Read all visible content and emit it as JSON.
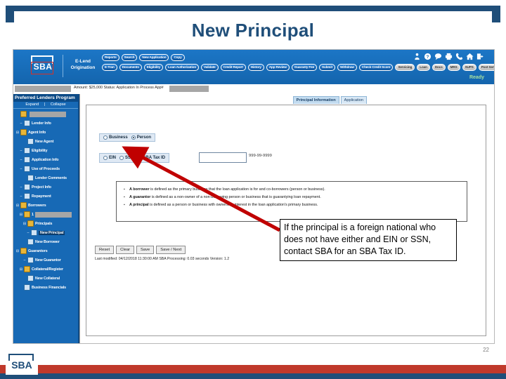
{
  "slide": {
    "title": "New Principal",
    "page_number": "22"
  },
  "app": {
    "brand": "SBA",
    "product_line1": "E-Lend",
    "product_line2": "Origination",
    "status": "Ready",
    "nav_row1": [
      "Reports",
      "Search",
      "New Application",
      "Copy"
    ],
    "nav_row2": [
      {
        "label": "E-Tran",
        "style": "blue"
      },
      {
        "label": "Documents",
        "style": "blue"
      },
      {
        "label": "Eligibility",
        "style": "blue"
      },
      {
        "label": "Loan Authorization",
        "style": "blue"
      },
      {
        "label": "Validate",
        "style": "blue"
      },
      {
        "label": "Credit Report",
        "style": "blue"
      },
      {
        "label": "History",
        "style": "blue"
      },
      {
        "label": "App Review",
        "style": "blue"
      },
      {
        "label": "Guaranty Fee",
        "style": "blue"
      },
      {
        "label": "Submit",
        "style": "blue"
      },
      {
        "label": "Withdraw",
        "style": "blue"
      },
      {
        "label": "Check Credit Score",
        "style": "blue"
      },
      {
        "label": "Servicing",
        "style": "gray"
      },
      {
        "label": "Loan",
        "style": "gray"
      },
      {
        "label": "Docs",
        "style": "gray"
      },
      {
        "label": "MRS",
        "style": "gray"
      },
      {
        "label": "SUPS",
        "style": "gray"
      },
      {
        "label": "Post Servicing",
        "style": "gray"
      }
    ],
    "icons": [
      "user-icon",
      "help-icon",
      "chat-icon",
      "print-icon",
      "phone-icon",
      "home-icon",
      "logout-icon"
    ]
  },
  "status_strip": {
    "text": "Amount: $25,000  Status: Application In Process  App#"
  },
  "tree": {
    "title": "Preferred Lenders Program",
    "expand": "Expand",
    "separator": "|",
    "collapse": "Collapse",
    "items": [
      {
        "label": "",
        "redacted": true,
        "icon": "folder",
        "indent": 0,
        "twist": ""
      },
      {
        "label": "Lender Info",
        "icon": "page",
        "indent": 1,
        "twist": "–"
      },
      {
        "label": "Agent Info",
        "icon": "folder",
        "indent": 0,
        "twist": "⊟"
      },
      {
        "label": "New Agent",
        "icon": "page",
        "indent": 2,
        "twist": ""
      },
      {
        "label": "Eligibility",
        "icon": "page",
        "indent": 1,
        "twist": "–"
      },
      {
        "label": "Application Info",
        "icon": "page",
        "indent": 1,
        "twist": "–"
      },
      {
        "label": "Use of Proceeds",
        "icon": "page",
        "indent": 1,
        "twist": "–"
      },
      {
        "label": "Lender Comments",
        "icon": "page",
        "indent": 2,
        "twist": ""
      },
      {
        "label": "Project Info",
        "icon": "page",
        "indent": 1,
        "twist": "–"
      },
      {
        "label": "Repayment",
        "icon": "page",
        "indent": 1,
        "twist": "–"
      },
      {
        "label": "Borrowers",
        "icon": "folder",
        "indent": 0,
        "twist": "⊟"
      },
      {
        "label": "1",
        "redacted": true,
        "icon": "folder",
        "indent": 1,
        "twist": "⊟"
      },
      {
        "label": "Principals",
        "icon": "folder",
        "indent": 2,
        "twist": "⊟"
      },
      {
        "label": "New Principal",
        "icon": "page",
        "indent": 3,
        "twist": "–",
        "selected": true
      },
      {
        "label": "New Borrower",
        "icon": "page",
        "indent": 2,
        "twist": ""
      },
      {
        "label": "Guarantors",
        "icon": "folder",
        "indent": 0,
        "twist": "⊟"
      },
      {
        "label": "New Guarantor",
        "icon": "page",
        "indent": 2,
        "twist": "–"
      },
      {
        "label": "Collateral/Register",
        "icon": "folder",
        "indent": 1,
        "twist": "⊟"
      },
      {
        "label": "New Collateral",
        "icon": "page",
        "indent": 2,
        "twist": ""
      },
      {
        "label": "Business Financials",
        "icon": "page",
        "indent": 1,
        "twist": ""
      }
    ]
  },
  "main": {
    "tabs": [
      {
        "label": "Principal Information",
        "active": true
      },
      {
        "label": "Application",
        "active": false
      }
    ],
    "entity_type": {
      "options": [
        {
          "label": "Business",
          "selected": false
        },
        {
          "label": "Person",
          "selected": true
        }
      ]
    },
    "id_type": {
      "options": [
        {
          "label": "EIN",
          "selected": false
        },
        {
          "label": "SSN",
          "selected": false
        },
        {
          "label": "SBA Tax ID",
          "selected": false
        }
      ],
      "input_value": "",
      "format_hint": "999-99-9999"
    },
    "definitions": [
      {
        "term": "A borrower",
        "rest": " is defined as the primary business that the loan application is for and co-borrowers (person or business)."
      },
      {
        "term": "A guarantor",
        "rest": " is defined as a non-owner of a non-borrowing person or business that is guarantying loan repayment."
      },
      {
        "term": "A principal",
        "rest": " is defined as a person or business with ownership interest in the loan application's primary business."
      }
    ],
    "buttons": [
      "Reset",
      "Clear",
      "Save",
      "Save / Next"
    ],
    "last_modified": "Last modified: 04/12/2018 11:30:00 AM   SBA Processing: 0.03 seconds   Version: 1.2"
  },
  "callout": {
    "text": "If the principal is a foreign national who does not have either and EIN or SSN, contact SBA for an SBA Tax ID."
  },
  "colors": {
    "brand_blue": "#1f4e79",
    "app_blue": "#1769b5",
    "accent_red": "#c0392b",
    "arrow_red": "#c00000"
  }
}
